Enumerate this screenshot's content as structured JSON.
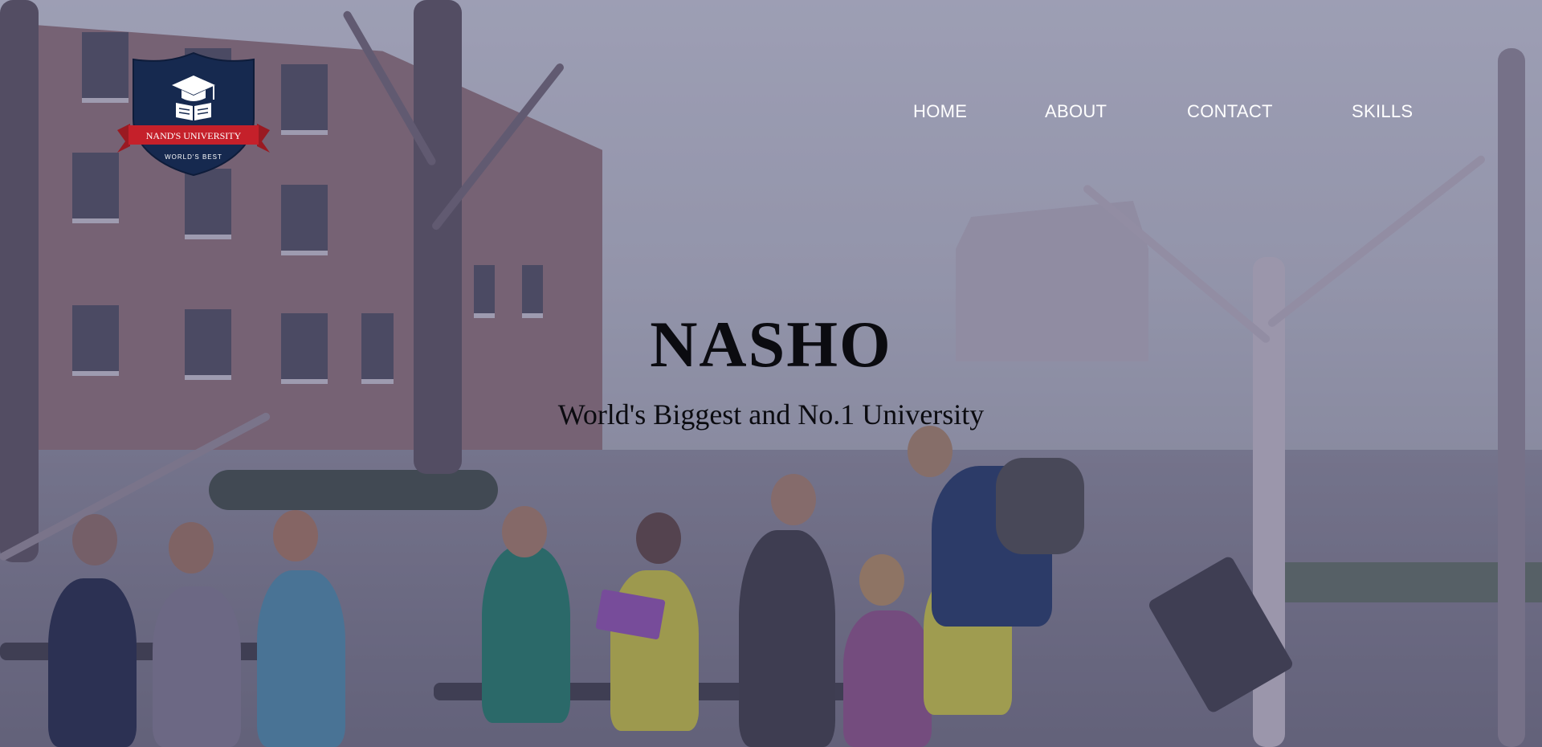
{
  "logo": {
    "ribbon_text": "NAND'S UNIVERSITY",
    "motto": "WORLD'S BEST",
    "icon": "graduation-cap-book-icon",
    "colors": {
      "shield": "#16294f",
      "ribbon": "#c5202a",
      "text": "#ffffff"
    }
  },
  "nav": {
    "items": [
      {
        "label": "HOME"
      },
      {
        "label": "ABOUT"
      },
      {
        "label": "CONTACT"
      },
      {
        "label": "SKILLS"
      }
    ]
  },
  "hero": {
    "title": "NASHO",
    "subtitle": "World's Biggest and No.1 University",
    "overlay_color": "#46486e"
  }
}
